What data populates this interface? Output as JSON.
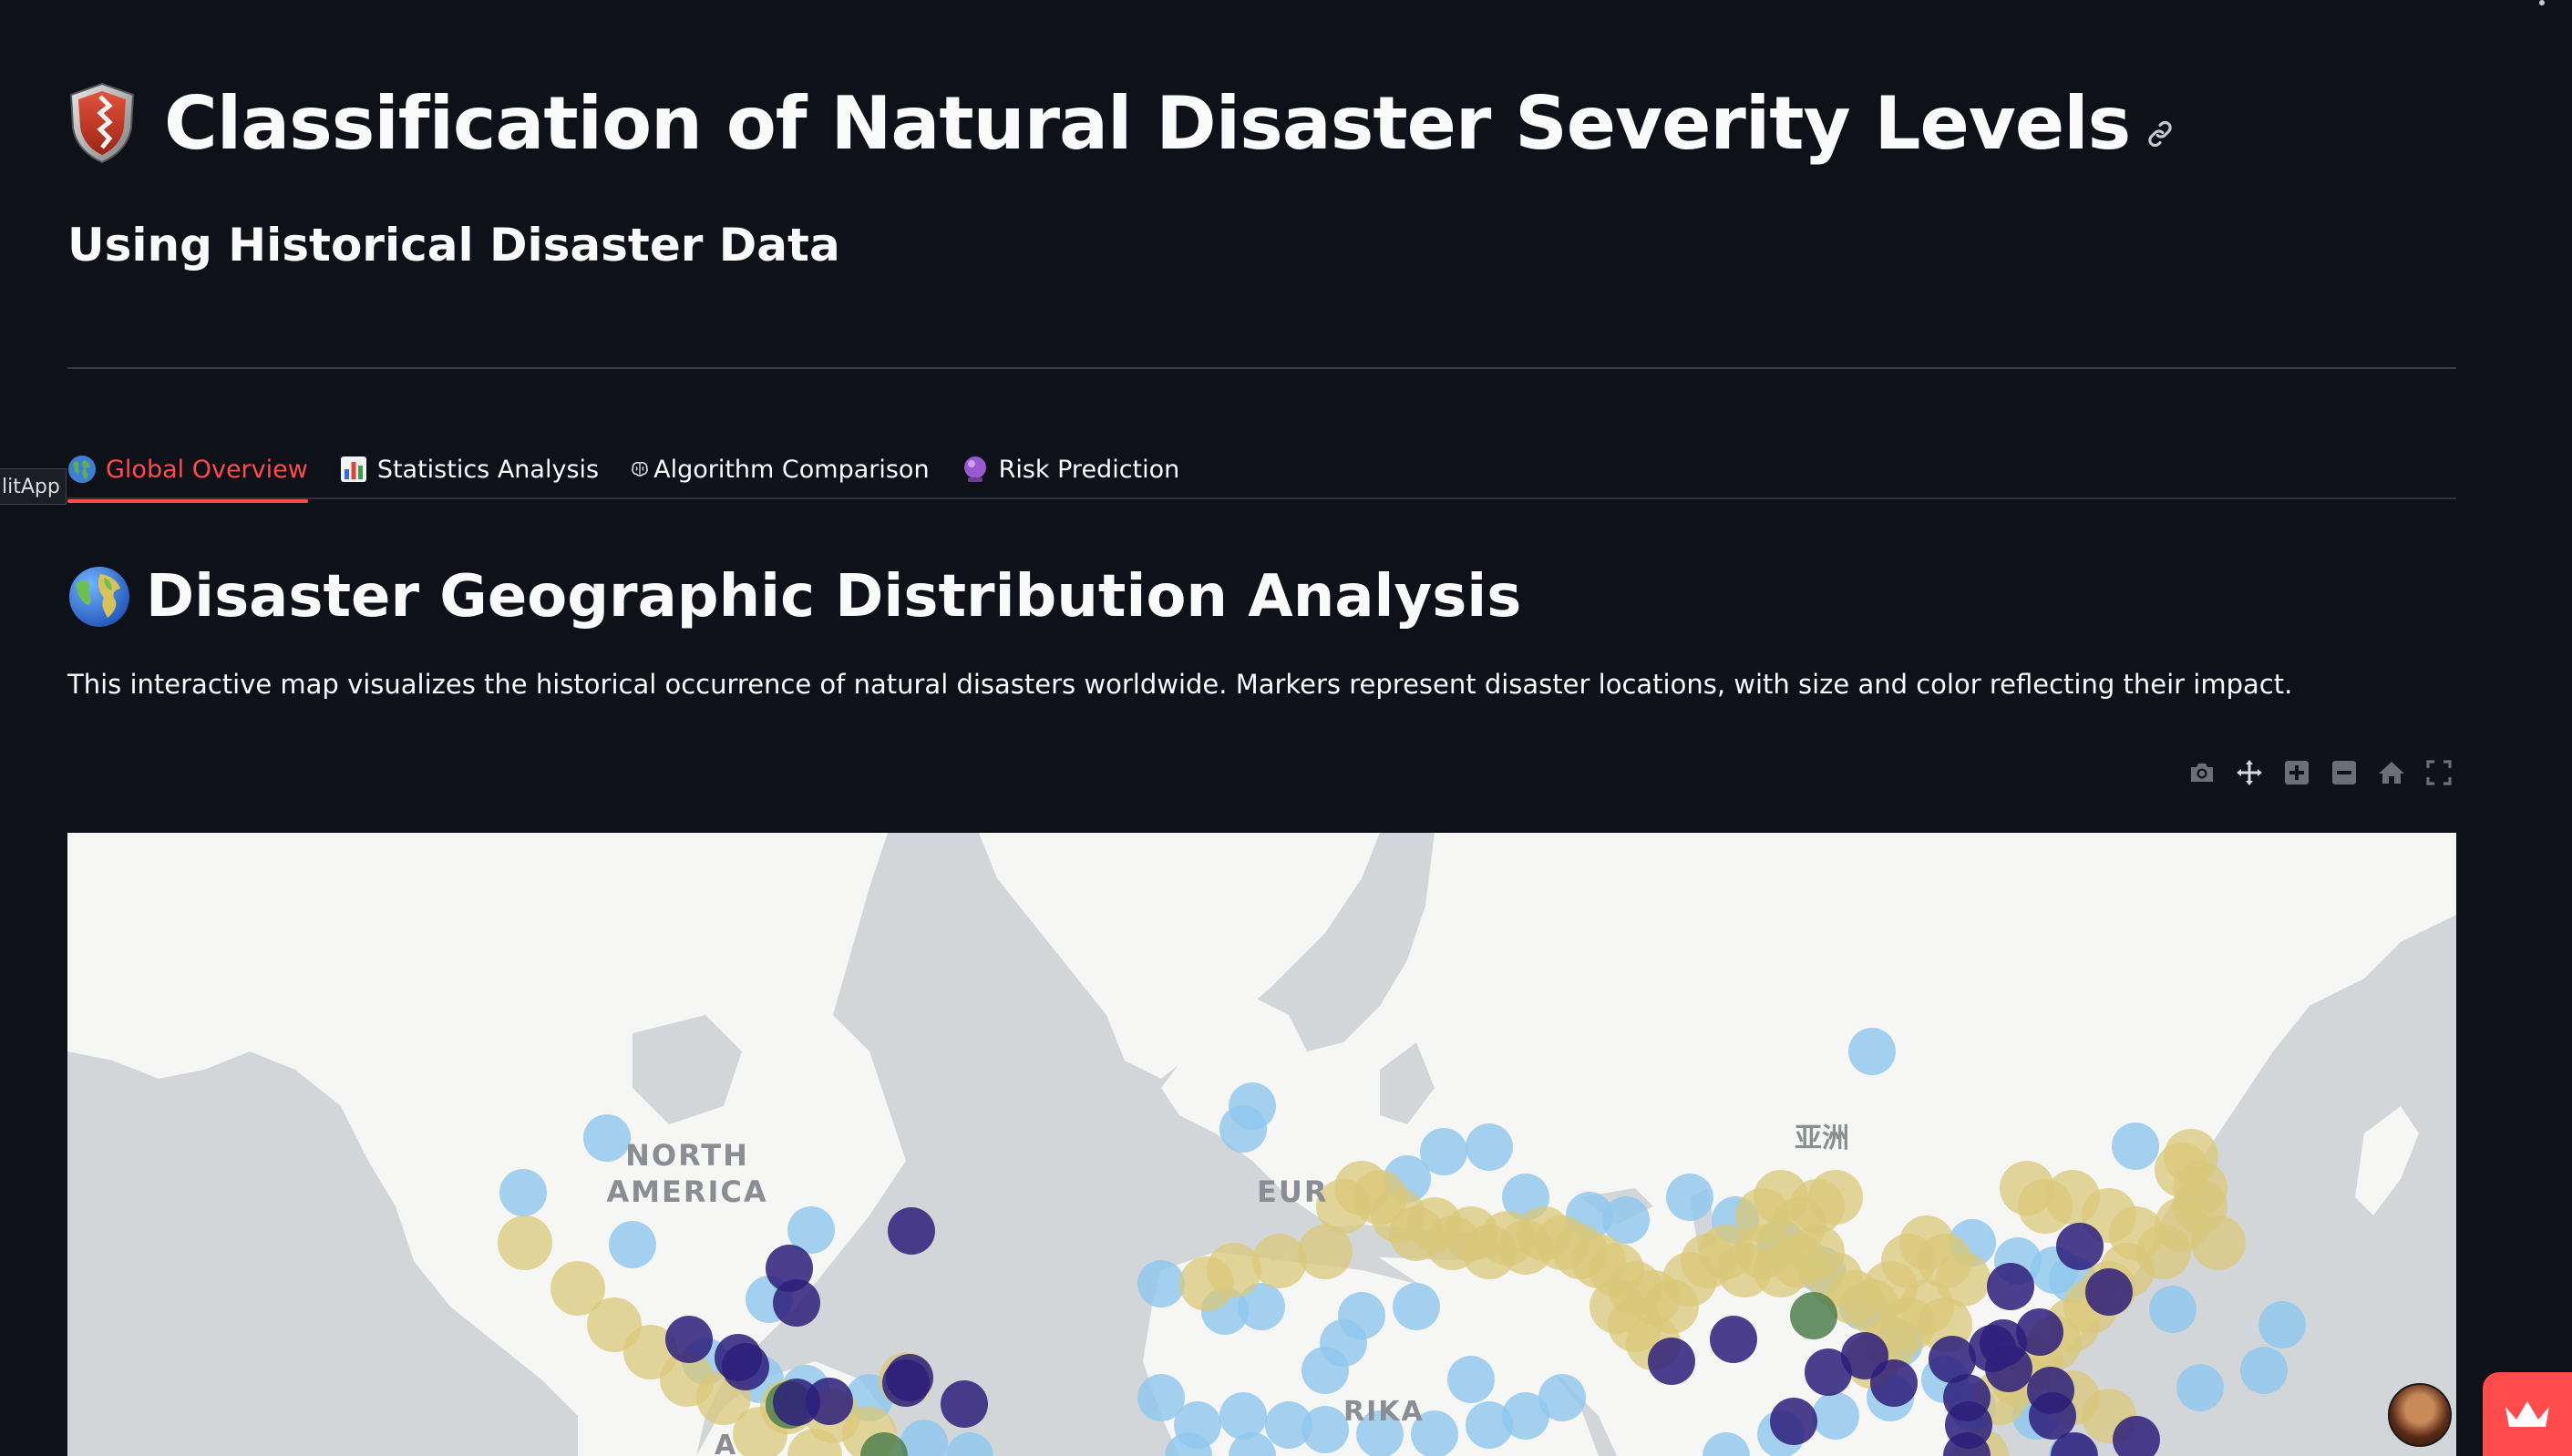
{
  "app": {
    "title": "Classification of Natural Disaster Severity Levels",
    "subtitle": "Using Historical Disaster Data",
    "side_tooltip": "litApp"
  },
  "tabs": [
    {
      "label": "Global Overview",
      "icon": "globe-icon",
      "active": true
    },
    {
      "label": "Statistics Analysis",
      "icon": "bar-chart-icon",
      "active": false
    },
    {
      "label": "Algorithm Comparison",
      "icon": "brain-icon",
      "active": false
    },
    {
      "label": "Risk Prediction",
      "icon": "crystal-ball-icon",
      "active": false
    }
  ],
  "section": {
    "title": "Disaster Geographic Distribution Analysis",
    "description": "This interactive map visualizes the historical occurrence of natural disasters worldwide. Markers represent disaster locations, with size and color reflecting their impact."
  },
  "modebar": [
    {
      "name": "camera-icon",
      "title": "Download plot as a png"
    },
    {
      "name": "pan-icon",
      "title": "Pan"
    },
    {
      "name": "zoom-in-icon",
      "title": "Zoom in"
    },
    {
      "name": "zoom-out-icon",
      "title": "Zoom out"
    },
    {
      "name": "home-icon",
      "title": "Reset view"
    },
    {
      "name": "fullscreen-icon",
      "title": "Fullscreen"
    }
  ],
  "map": {
    "labels": {
      "north_america": [
        "NORTH",
        "AMERICA"
      ],
      "europe": "EUR",
      "asia": "亚洲",
      "africa": "RIKA",
      "south": "A"
    },
    "colors": {
      "light_blue": "#8ec7ee",
      "yellow": "#d9c87a",
      "green": "#4f7f4d",
      "purple": "#2d1f7a",
      "ocean": "#d3d6d9",
      "land": "#f6f6f4"
    }
  },
  "colors": {
    "background": "#0e1117",
    "accent": "#ff4b4b",
    "text": "#fafafa"
  }
}
